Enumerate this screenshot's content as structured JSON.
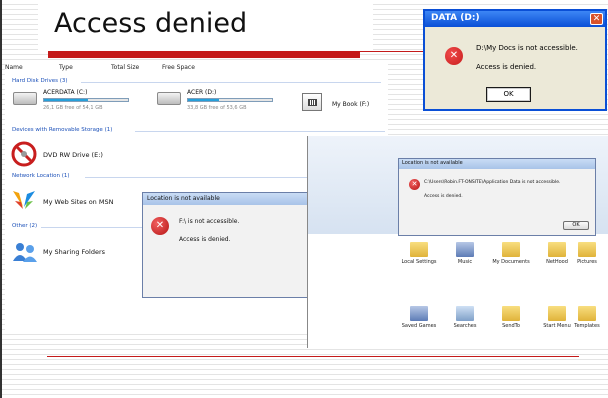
{
  "slide": {
    "title": "Access denied"
  },
  "explorer": {
    "columns": [
      "Name",
      "Type",
      "Total Size",
      "Free Space"
    ],
    "sections": {
      "hard_disk": "Hard Disk Drives (3)",
      "removable": "Devices with Removable Storage (1)",
      "network": "Network Location (1)",
      "other": "Other (2)"
    },
    "drives": [
      {
        "name": "ACERDATA (C:)",
        "free": "26,1 GB free of 54,1 GB",
        "fill_fraction": 0.52
      },
      {
        "name": "ACER (D:)",
        "free": "33,8 GB free of 53,6 GB",
        "fill_fraction": 0.37
      },
      {
        "name": "My Book (F:)"
      }
    ],
    "dvd": "DVD RW Drive (E:)",
    "network_item": "My Web Sites on MSN",
    "other_item": "My Sharing Folders"
  },
  "location_dialog": {
    "title": "Location is not available",
    "message": "F:\\ is not accessible.",
    "detail": "Access is denied.",
    "ok": "OK"
  },
  "xp_dialog": {
    "title": "DATA (D:)",
    "message": "D:\\My Docs is not accessible.",
    "detail": "Access is denied.",
    "ok": "OK",
    "close_icon": "close-icon"
  },
  "appdata_dialog": {
    "title": "Location is not available",
    "message": "C:\\Users\\Robin.FT-ONSITE\\Application Data is not accessible.",
    "detail": "Access is denied.",
    "ok": "OK"
  },
  "folders": {
    "row1": [
      "Local Settings",
      "Music",
      "My Documents",
      "NetHood",
      "Pictures"
    ],
    "row2": [
      "Saved Games",
      "Searches",
      "SendTo",
      "Start Menu",
      "Templates"
    ]
  },
  "colors": {
    "accent_rule": "#c41a1a",
    "xp_title": "#0a4fd6",
    "error_red": "#c81e1e",
    "bar_fill": "#26a0da"
  }
}
